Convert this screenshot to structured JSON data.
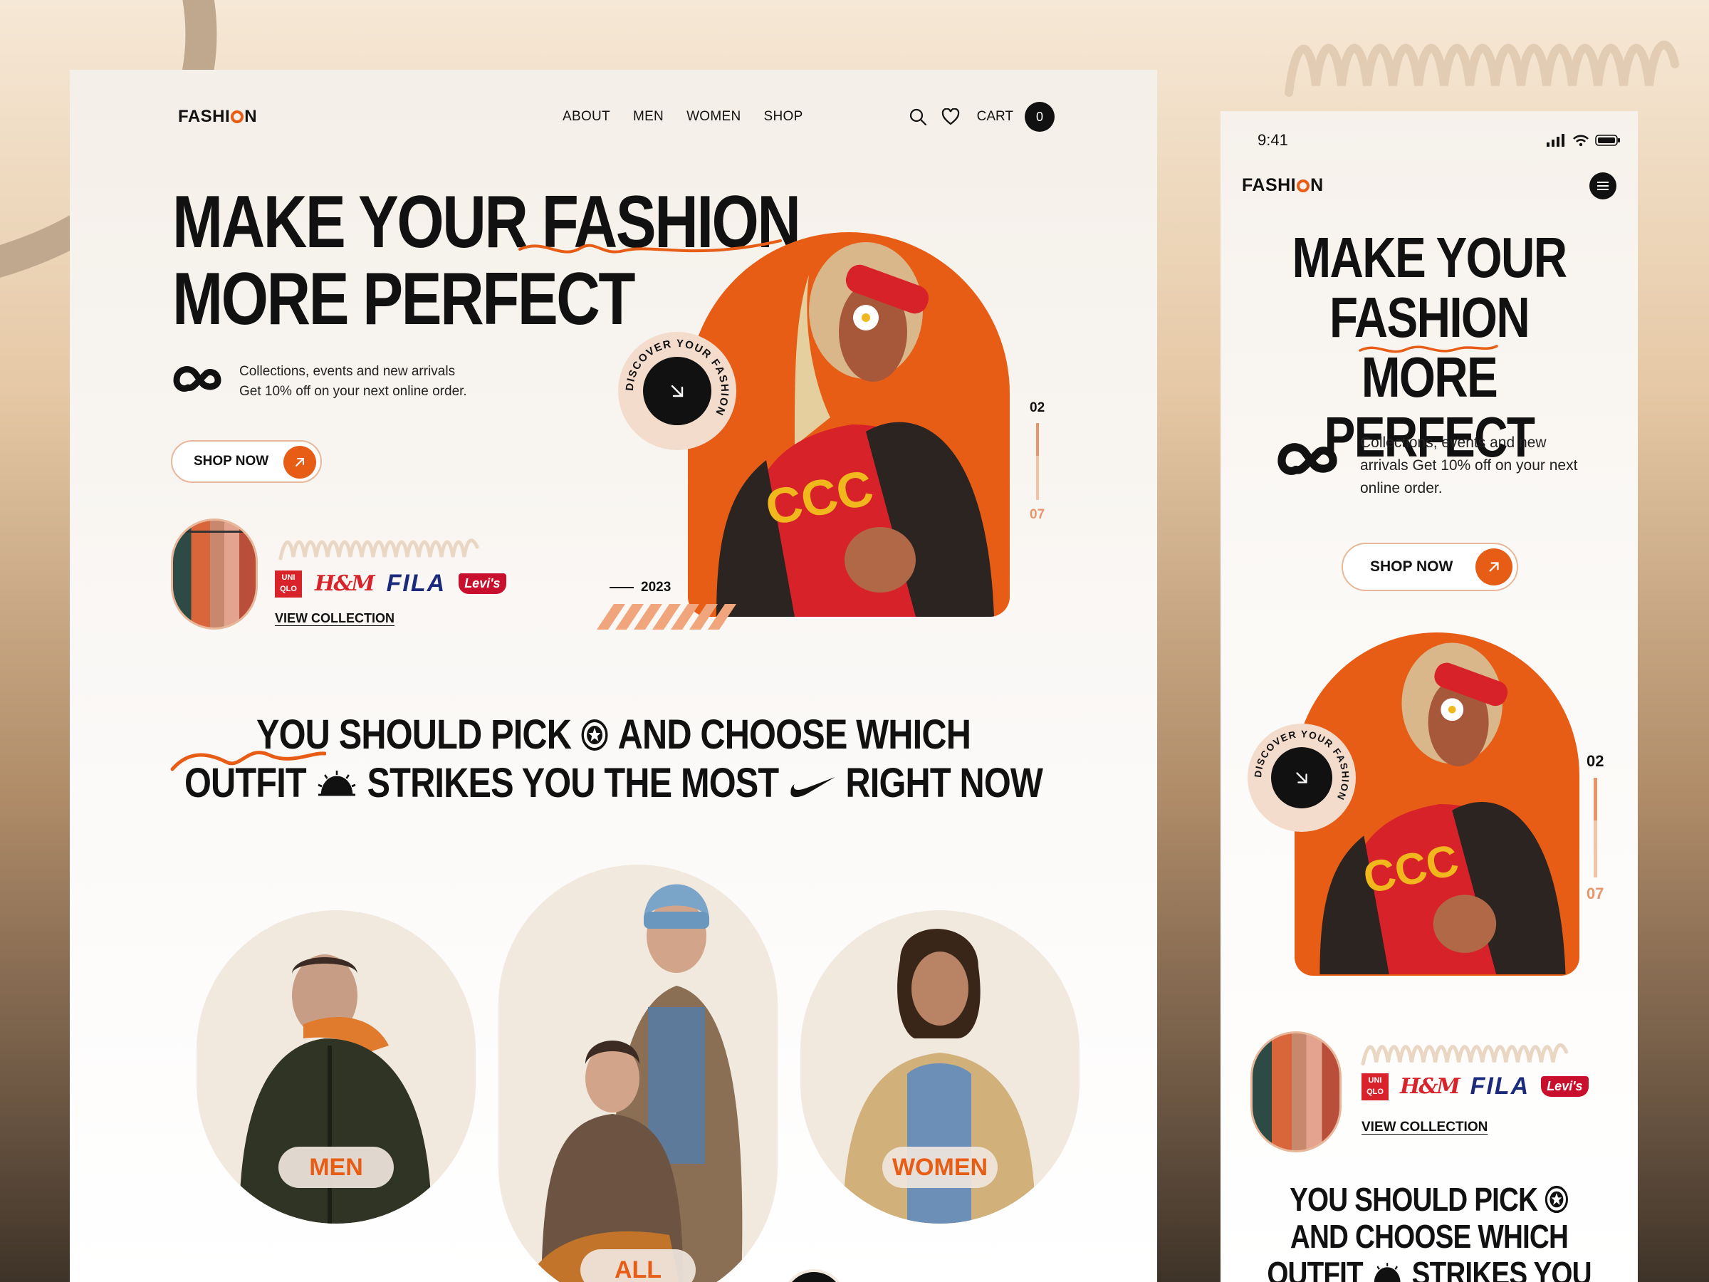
{
  "desktop": {
    "nav": {
      "logo": "FASHI",
      "logo_tail": "N",
      "links": [
        "ABOUT",
        "MEN",
        "WOMEN",
        "SHOP"
      ],
      "cart_label": "CART",
      "cart_count": "0"
    },
    "hero": {
      "title_line1": "MAKE YOUR FASHION",
      "title_line2": "MORE PERFECT",
      "sub_line1": "Collections, events and new arrivals",
      "sub_line2": "Get 10% off on your next online order.",
      "shop_button": "SHOP NOW",
      "stamp_text": "DISCOVER YOUR FASHION",
      "year": "2023",
      "pager_current": "02",
      "pager_total": "07",
      "view_collection": "VIEW COLLECTION"
    },
    "brands": {
      "uniqlo": [
        "UNI",
        "QLO"
      ],
      "hm": "H&M",
      "fila": "FILA",
      "levis": "Levi's"
    },
    "pick": {
      "row1_a": "YOU SHOULD PICK",
      "row1_b": "AND CHOOSE WHICH",
      "row2_a": "OUTFIT",
      "row2_b": "STRIKES YOU THE MOST",
      "row2_c": "RIGHT NOW"
    },
    "categories": {
      "men": "MEN",
      "all": "ALL",
      "women": "WOMEN"
    }
  },
  "mobile": {
    "status_time": "9:41",
    "logo": "FASHI",
    "logo_tail": "N",
    "title_line1": "MAKE YOUR",
    "title_line2": "FASHION",
    "title_line3": "MORE PERFECT",
    "sub": "Collections, events and new arrivals Get 10% off on your next online order.",
    "shop_button": "SHOP NOW",
    "pager_current": "02",
    "pager_total": "07",
    "view_collection": "VIEW COLLECTION",
    "pick_row1": "YOU SHOULD PICK",
    "pick_row2": "AND CHOOSE WHICH",
    "pick_row3_a": "OUTFIT",
    "pick_row3_b": "STRIKES YOU"
  },
  "colors": {
    "accent": "#e85d16",
    "peach": "#e8b79a",
    "cream": "#f1e8de",
    "ink": "#111111"
  }
}
